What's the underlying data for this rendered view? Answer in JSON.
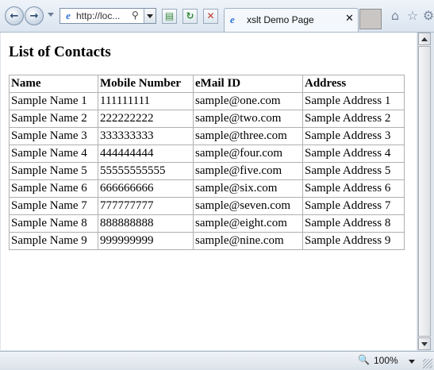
{
  "browser": {
    "address": "http://loc...",
    "tab_title": "xslt Demo Page",
    "zoom": "100%",
    "icons": {
      "back": "back-arrow-icon",
      "forward": "forward-arrow-icon",
      "compat": "compatibility-view-icon",
      "refresh": "refresh-icon",
      "stop": "stop-icon",
      "home": "home-icon",
      "favorites": "star-icon",
      "tools": "gear-icon"
    }
  },
  "page": {
    "title": "List of Contacts",
    "columns": [
      "Name",
      "Mobile Number",
      "eMail ID",
      "Address"
    ],
    "rows": [
      [
        "Sample Name 1",
        "111111111",
        "sample@one.com",
        "Sample Address 1"
      ],
      [
        "Sample Name 2",
        "222222222",
        "sample@two.com",
        "Sample Address 2"
      ],
      [
        "Sample Name 3",
        "333333333",
        "sample@three.com",
        "Sample Address 3"
      ],
      [
        "Sample Name 4",
        "444444444",
        "sample@four.com",
        "Sample Address 4"
      ],
      [
        "Sample Name 5",
        "55555555555",
        "sample@five.com",
        "Sample Address 5"
      ],
      [
        "Sample Name 6",
        "666666666",
        "sample@six.com",
        "Sample Address 6"
      ],
      [
        "Sample Name 7",
        "777777777",
        "sample@seven.com",
        "Sample Address 7"
      ],
      [
        "Sample Name 8",
        "888888888",
        "sample@eight.com",
        "Sample Address 8"
      ],
      [
        "Sample Name 9",
        "999999999",
        "sample@nine.com",
        "Sample Address 9"
      ]
    ]
  }
}
